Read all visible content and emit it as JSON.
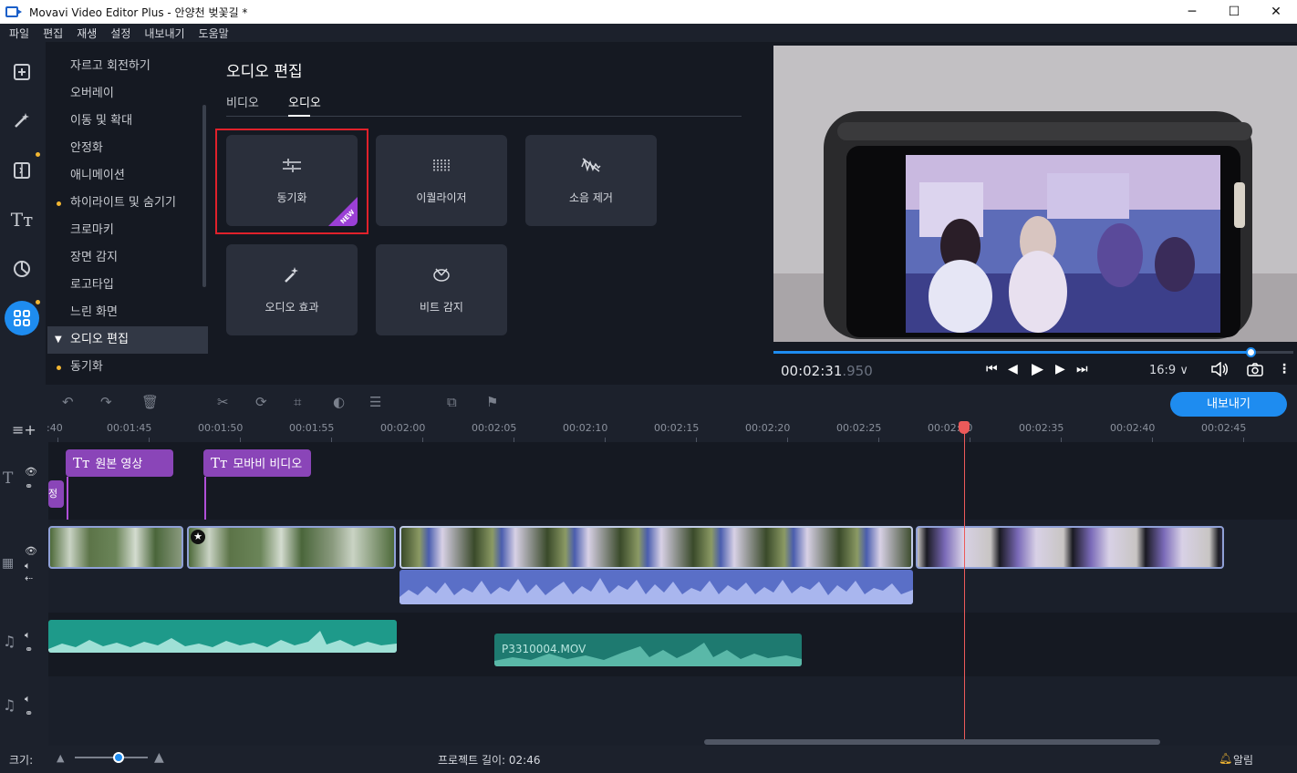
{
  "window": {
    "title": "Movavi Video Editor Plus - 안양천 벚꽃길 *",
    "minimize": "─",
    "maximize": "☐",
    "close": "✕"
  },
  "menu": [
    "파일",
    "편집",
    "재생",
    "설정",
    "내보내기",
    "도움말"
  ],
  "tools": {
    "items": [
      {
        "label": "자르고 회전하기"
      },
      {
        "label": "오버레이"
      },
      {
        "label": "이동 및 확대"
      },
      {
        "label": "안정화"
      },
      {
        "label": "애니메이션"
      },
      {
        "label": "하이라이트 및 숨기기"
      },
      {
        "label": "크로마키"
      },
      {
        "label": "장면 감지"
      },
      {
        "label": "로고타입"
      },
      {
        "label": "느린 화면"
      },
      {
        "label": "오디오 편집"
      },
      {
        "label": "동기화"
      }
    ]
  },
  "panel": {
    "title": "오디오 편집",
    "tabs": [
      "비디오",
      "오디오"
    ],
    "active_tab": "오디오",
    "cards": [
      {
        "label": "동기화",
        "icon": "sync-icon",
        "badge": "NEW"
      },
      {
        "label": "이퀄라이저",
        "icon": "equalizer-icon"
      },
      {
        "label": "소음 제거",
        "icon": "noise-removal-icon"
      },
      {
        "label": "오디오 효과",
        "icon": "audio-effects-icon"
      },
      {
        "label": "비트 감지",
        "icon": "beat-detection-icon"
      }
    ]
  },
  "player": {
    "timecode": "00:02:31",
    "timecode_ms": ".950",
    "progress": 0.92,
    "aspect": "16:9 ∨"
  },
  "timeline": {
    "export_label": "내보내기",
    "ruler": [
      ":40",
      "00:01:45",
      "00:01:50",
      "00:01:55",
      "00:02:00",
      "00:02:05",
      "00:02:10",
      "00:02:15",
      "00:02:20",
      "00:02:25",
      "00:02:30",
      "00:02:35",
      "00:02:40",
      "00:02:45"
    ],
    "title_clips": [
      "원본 영상",
      "모바비 비디오",
      "정호"
    ],
    "audio_clip_name": "P3310004.MOV"
  },
  "status": {
    "size_label": "크기:",
    "project_length": "프로젝트 길이:  02:46",
    "notifications": "알림"
  },
  "colors": {
    "accent": "#1e8cf0",
    "title_clip": "#8a45b8",
    "playhead": "#ec5a5a",
    "highlight": "#e0212b"
  }
}
